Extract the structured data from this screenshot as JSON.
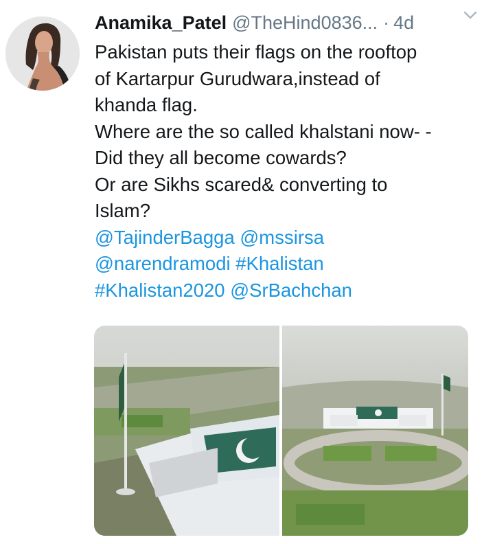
{
  "tweet": {
    "author": {
      "display_name": "Anamika_Patel",
      "handle": "@TheHind0836...",
      "avatar_icon": "profile-photo"
    },
    "separator": "·",
    "timestamp": "4d",
    "caret_icon": "chevron-down-icon",
    "text_lines": [
      "Pakistan puts their flags on the rooftop",
      "of Kartarpur Gurudwara,instead of",
      "khanda flag.",
      "Where are the so called khalstani now- -",
      "Did they all become cowards?",
      "Or are Sikhs scared& converting to",
      "Islam?"
    ],
    "mentions_line1": [
      "@TajinderBagga",
      "@mssirsa"
    ],
    "mentions_line2": [
      "@narendramodi",
      "#Khalistan"
    ],
    "mentions_line3": [
      "#Khalistan2020",
      "@SrBachchan"
    ],
    "colors": {
      "link": "#1b95e0",
      "secondary_text": "#657786",
      "primary_text": "#14171a"
    },
    "media": [
      {
        "name": "photo-kartarpur-flag-closeup"
      },
      {
        "name": "photo-kartarpur-aerial-wide"
      }
    ]
  }
}
